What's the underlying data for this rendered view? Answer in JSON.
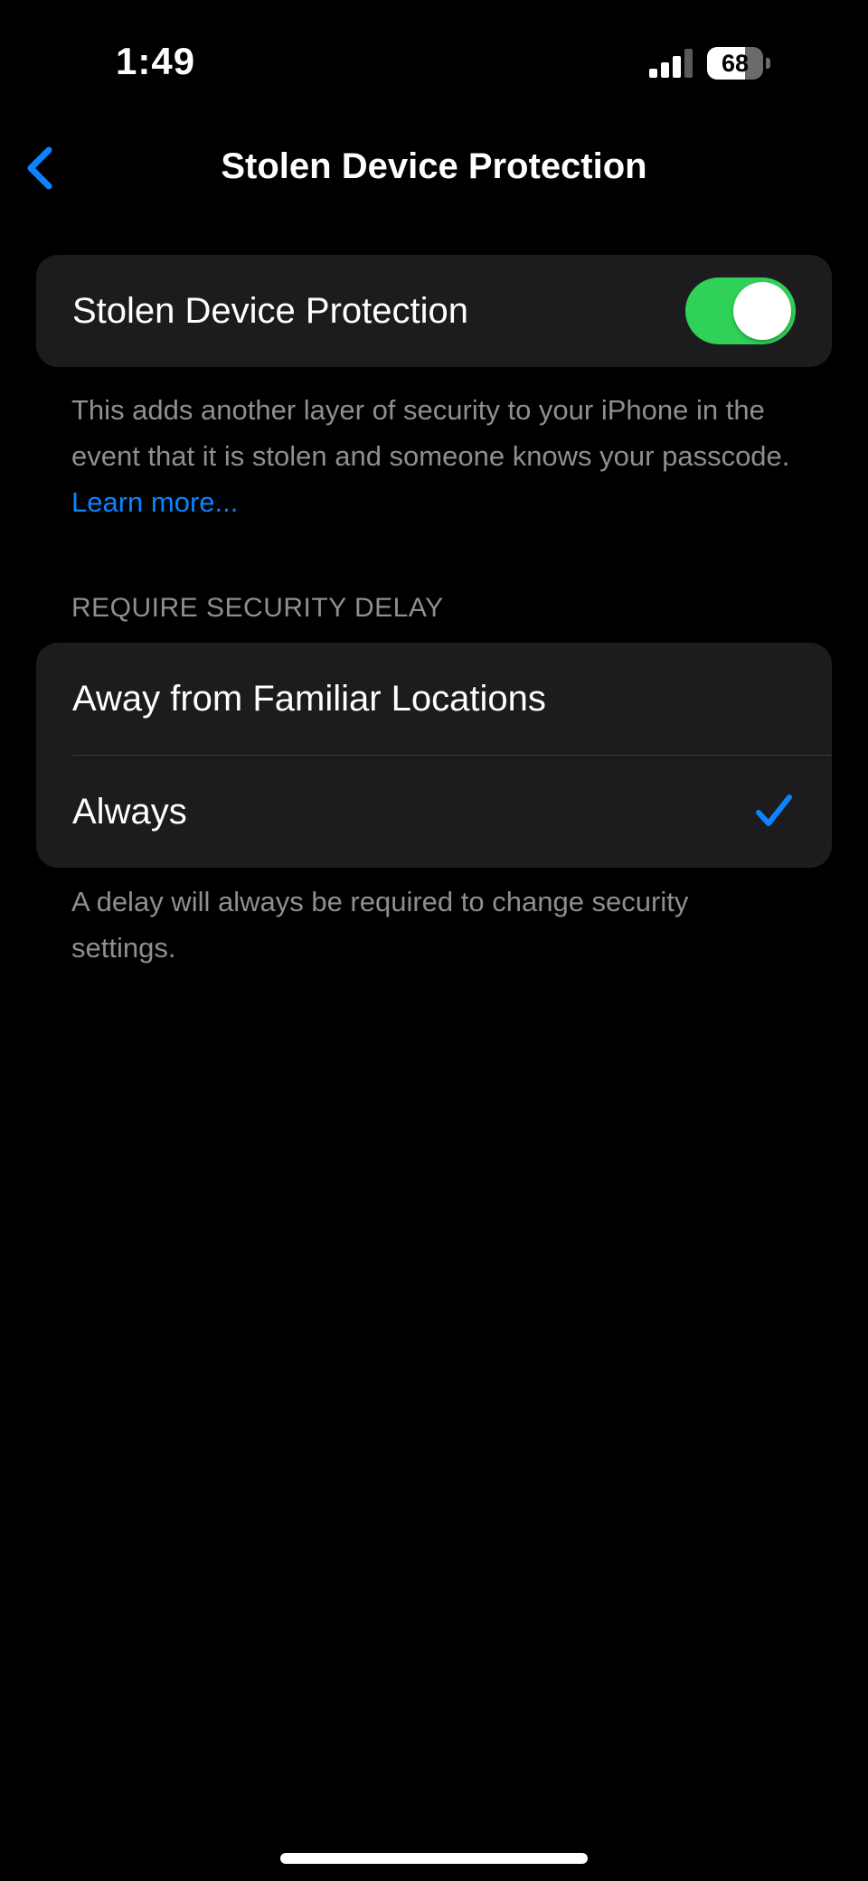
{
  "status_bar": {
    "time": "1:49",
    "battery_level": "68"
  },
  "nav": {
    "back_icon": "chevron-left-icon",
    "title": "Stolen Device Protection"
  },
  "protection": {
    "toggle_label": "Stolen Device Protection",
    "toggle_on": true,
    "description": "This adds another layer of security to your iPhone in the event that it is stolen and someone knows your passcode. ",
    "learn_more": "Learn more..."
  },
  "security_delay": {
    "header": "REQUIRE SECURITY DELAY",
    "options": [
      {
        "label": "Away from Familiar Locations",
        "selected": false
      },
      {
        "label": "Always",
        "selected": true
      }
    ],
    "footer": "A delay will always be required to change security settings."
  },
  "colors": {
    "accent": "#0a84ff",
    "toggle_on": "#30d158",
    "group_bg": "#1c1c1e",
    "secondary_text": "#8e8e93"
  }
}
